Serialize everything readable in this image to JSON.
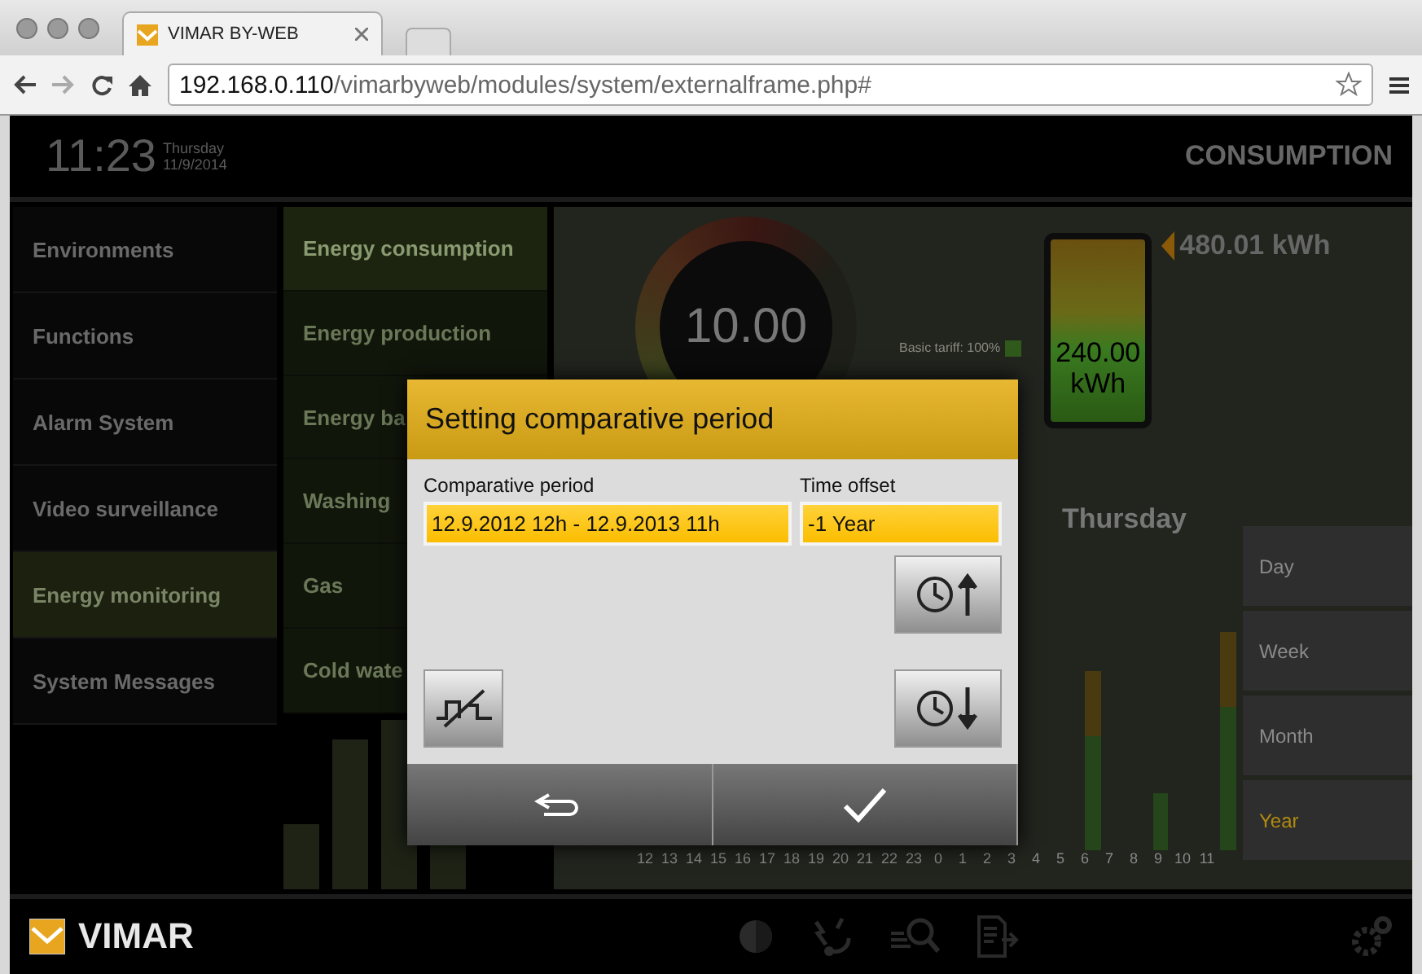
{
  "browser": {
    "tab_title": "VIMAR BY-WEB",
    "url_host": "192.168.0.110",
    "url_path": "/vimarbyweb/modules/system/externalframe.php#"
  },
  "header": {
    "time": "11:23",
    "weekday": "Thursday",
    "date": "11/9/2014",
    "page_title": "CONSUMPTION"
  },
  "menu": [
    {
      "label": "Environments",
      "selected": false
    },
    {
      "label": "Functions",
      "selected": false
    },
    {
      "label": "Alarm System",
      "selected": false
    },
    {
      "label": "Video surveillance",
      "selected": false
    },
    {
      "label": "Energy monitoring",
      "selected": true
    },
    {
      "label": "System Messages",
      "selected": false
    }
  ],
  "submenu": [
    {
      "label": "Energy consumption",
      "selected": true
    },
    {
      "label": "Energy production",
      "selected": false
    },
    {
      "label": "Energy ba",
      "selected": false
    },
    {
      "label": "Washing",
      "selected": false
    },
    {
      "label": "Gas",
      "selected": false
    },
    {
      "label": "Cold wate",
      "selected": false
    }
  ],
  "gauge": {
    "value": "10.00",
    "tariff": "Basic tariff: 100%"
  },
  "battery": {
    "reading": "240.00",
    "unit": "kWh"
  },
  "total": "480.01 kWh",
  "day_label": "Thursday",
  "hours": [
    "12",
    "13",
    "14",
    "15",
    "16",
    "17",
    "18",
    "19",
    "20",
    "21",
    "22",
    "23",
    "0",
    "1",
    "2",
    "3",
    "4",
    "5",
    "6",
    "7",
    "8",
    "9",
    "10",
    "11"
  ],
  "periods": [
    {
      "label": "Day",
      "selected": false
    },
    {
      "label": "Week",
      "selected": false
    },
    {
      "label": "Month",
      "selected": false
    },
    {
      "label": "Year",
      "selected": true
    }
  ],
  "dialog": {
    "title": "Setting comparative period",
    "period_label": "Comparative period",
    "period_value": "12.9.2012 12h - 12.9.2013 11h",
    "offset_label": "Time offset",
    "offset_value": "-1 Year"
  },
  "footer": {
    "brand": "VIMAR"
  }
}
